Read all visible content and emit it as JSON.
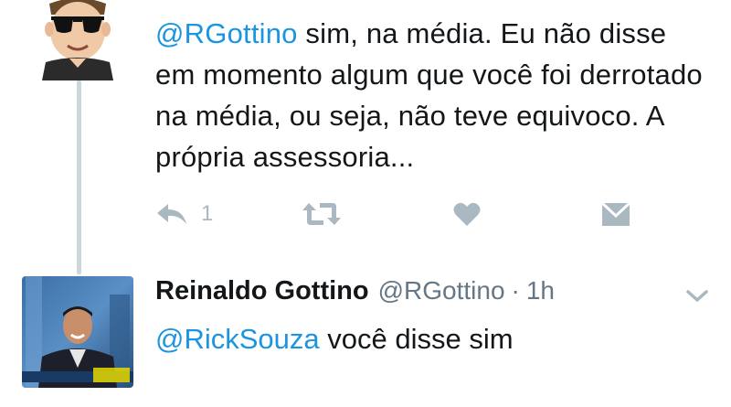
{
  "tweet1": {
    "mention": "@RGottino",
    "text": " sim, na média. Eu não disse em momento algum que você foi derrotado na média, ou seja, não teve equivoco. A própria assessoria...",
    "reply_count": "1",
    "avatar_icon": "cartoon-sunglasses-avatar-icon"
  },
  "tweet2": {
    "name": "Reinaldo Gottino",
    "handle": "@RGottino",
    "separator": "·",
    "time": "1h",
    "mention": "@RickSouza",
    "text": " você disse sim",
    "avatar_icon": "tv-presenter-photo-avatar"
  },
  "colors": {
    "link": "#1b95e0",
    "icon": "#aab8c2",
    "thread_line": "#ccd6dd",
    "secondary_text": "#657786"
  },
  "icons": [
    "reply-icon",
    "retweet-icon",
    "like-icon",
    "direct-message-icon",
    "chevron-down-icon"
  ]
}
